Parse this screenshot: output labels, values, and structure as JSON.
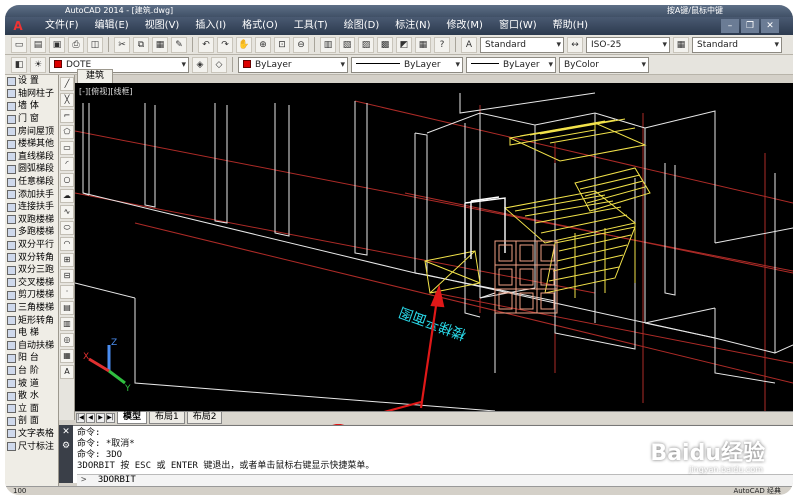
{
  "window": {
    "title": "AutoCAD 2014 - [建筑.dwg]",
    "frame_note": "按A键/鼠标中键"
  },
  "menu": {
    "items": [
      "文件(F)",
      "编辑(E)",
      "视图(V)",
      "插入(I)",
      "格式(O)",
      "工具(T)",
      "绘图(D)",
      "标注(N)",
      "修改(M)",
      "窗口(W)",
      "帮助(H)"
    ]
  },
  "toolbar": {
    "text_style": "Standard",
    "dim_style": "ISO-25",
    "table_style": "Standard",
    "layer_name": "DOTE",
    "color": "ByLayer",
    "linetype": "ByLayer",
    "lineweight": "ByLayer",
    "plotstyle": "ByColor"
  },
  "left_palette": {
    "items": [
      "设  置",
      "轴网柱子",
      "墙  体",
      "门  窗",
      "房间屋顶",
      "楼梯其他",
      "直线梯段",
      "圆弧梯段",
      "任意梯段",
      "添加扶手",
      "连接扶手",
      "双跑楼梯",
      "多跑楼梯",
      "双分平行",
      "双分转角",
      "双分三跑",
      "交叉楼梯",
      "剪刀楼梯",
      "三角楼梯",
      "矩形转角",
      "电  梯",
      "自动扶梯",
      "阳  台",
      "台  阶",
      "坡  道",
      "散  水",
      "立  面",
      "剖  面",
      "文字表格",
      "尺寸标注"
    ]
  },
  "drawing": {
    "tab_label": "建筑",
    "view_label": "[-][俯视][线框]",
    "annotation_text": "楼梯平面图",
    "ucs_x": "X",
    "ucs_y": "Y",
    "ucs_z": "Z"
  },
  "layout_tabs": [
    "模型",
    "布局1",
    "布局2"
  ],
  "command": {
    "lines": [
      "命令:",
      "命令: *取消*",
      "命令: 3DO",
      "3DORBIT 按 ESC 或 ENTER 键退出，或者单击鼠标右键显示快捷菜单。"
    ],
    "input_prompt": ">",
    "input_value": "3DORBIT"
  },
  "status": {
    "coords": "100",
    "right_text": "AutoCAD 经典"
  },
  "watermark": {
    "brand": "Baidu经验",
    "url": "jingyan.baidu.com"
  }
}
